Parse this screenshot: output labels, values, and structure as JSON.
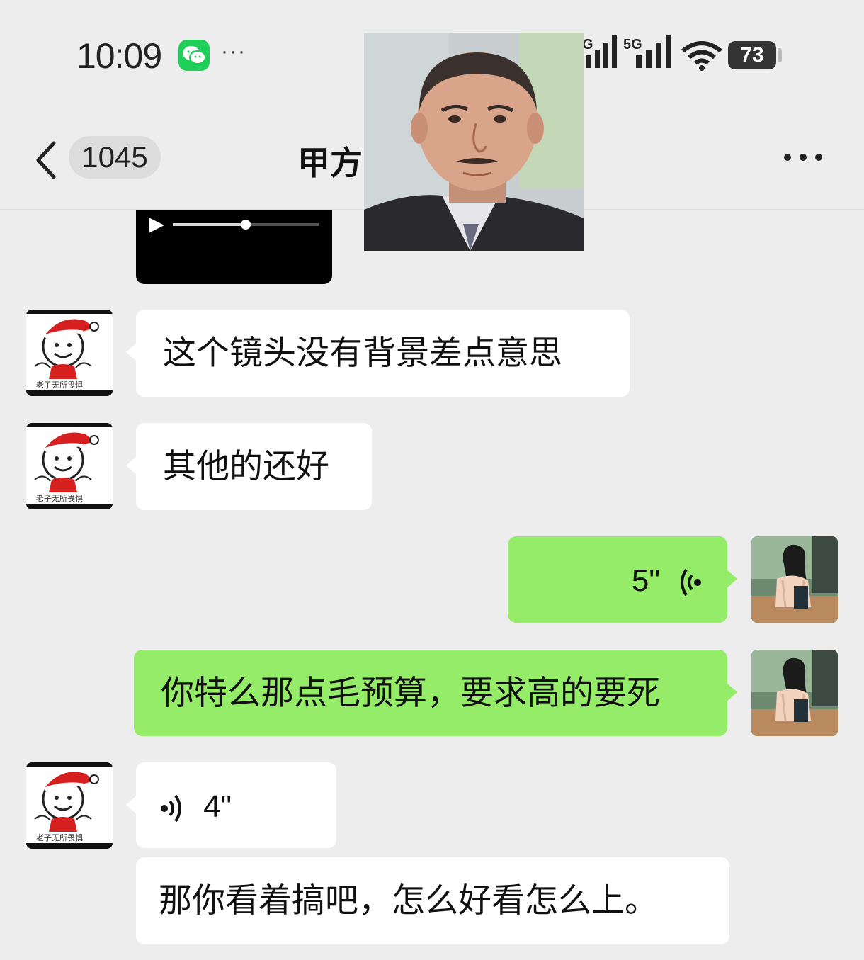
{
  "status_bar": {
    "time": "10:09",
    "more_dots": "···",
    "network_1": "G",
    "network_2": "5G",
    "battery": "73"
  },
  "nav": {
    "unread_count": "1045",
    "title": "甲方"
  },
  "messages": [
    {
      "side": "left",
      "type": "text",
      "text": "这个镜头没有背景差点意思"
    },
    {
      "side": "left",
      "type": "text",
      "text": "其他的还好"
    },
    {
      "side": "right",
      "type": "voice",
      "duration": "5\""
    },
    {
      "side": "right",
      "type": "text",
      "text": "你特么那点毛预算，要求高的要死"
    },
    {
      "side": "left",
      "type": "voice",
      "duration": "4\""
    },
    {
      "side": "left",
      "type": "text",
      "text": "那你看着搞吧，怎么好看怎么上。"
    }
  ],
  "avatar_caption": "老子无所畏惧",
  "colors": {
    "background": "#ededed",
    "incoming_bubble": "#ffffff",
    "outgoing_bubble": "#95ec69",
    "wechat_green": "#1fcf5a"
  },
  "icons": [
    "wechat-icon",
    "signal-icon",
    "wifi-icon",
    "battery-icon",
    "back-chevron-icon",
    "more-icon",
    "play-icon",
    "voice-wave-icon"
  ]
}
